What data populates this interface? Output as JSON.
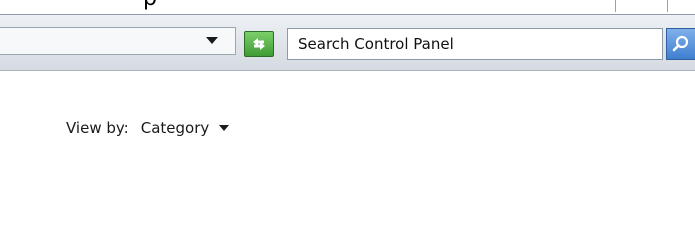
{
  "toolbar": {
    "search": {
      "placeholder": "Search Control Panel"
    }
  },
  "main": {
    "view_by": {
      "label": "View by:",
      "selected": "Category"
    }
  },
  "icons": {
    "refresh": "refresh-icon",
    "search": "magnifier-icon",
    "address_dropdown": "chevron-down-icon",
    "view_by_dropdown": "chevron-down-icon"
  },
  "colors": {
    "toolbar_bg": "#dfe4ea",
    "refresh_green": "#3f9b35",
    "search_blue": "#3f7fd0"
  }
}
